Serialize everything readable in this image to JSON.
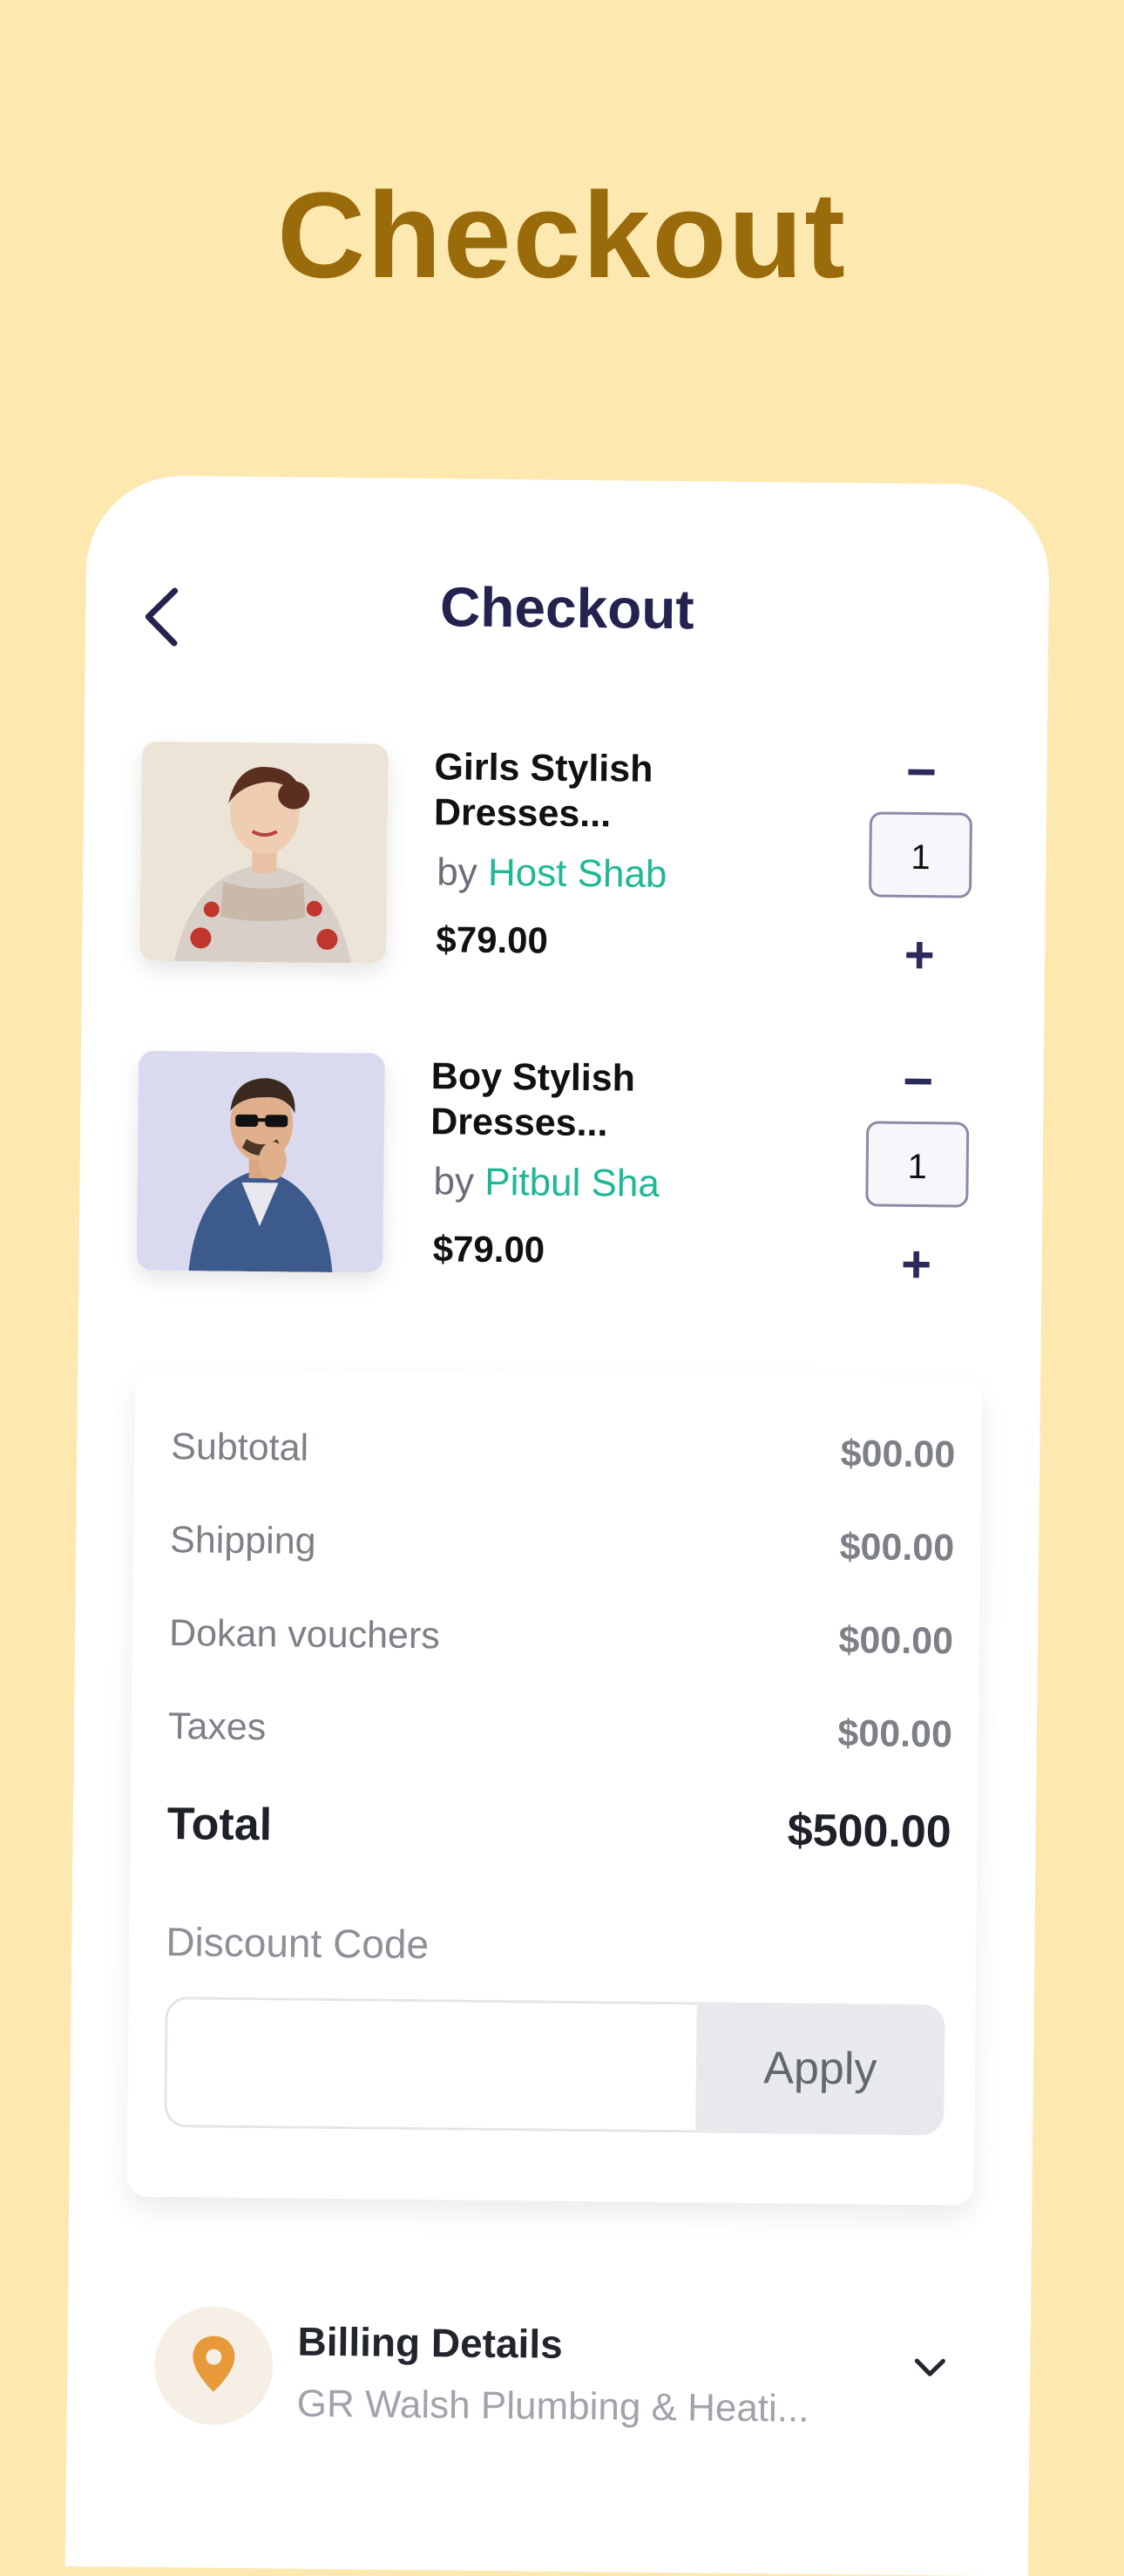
{
  "hero": {
    "title": "Checkout"
  },
  "header": {
    "title": "Checkout"
  },
  "items": [
    {
      "name": "Girls Stylish Dresses...",
      "by": "by",
      "seller": "Host Shab",
      "price": "$79.00",
      "quantity": "1"
    },
    {
      "name": "Boy Stylish Dresses...",
      "by": "by",
      "seller": "Pitbul Sha",
      "price": "$79.00",
      "quantity": "1"
    }
  ],
  "qty_controls": {
    "minus": "−",
    "plus": "+"
  },
  "summary": {
    "subtotal_label": "Subtotal",
    "subtotal_value": "$00.00",
    "shipping_label": "Shipping",
    "shipping_value": "$00.00",
    "vouchers_label": "Dokan vouchers",
    "vouchers_value": "$00.00",
    "taxes_label": "Taxes",
    "taxes_value": "$00.00",
    "total_label": "Total",
    "total_value": "$500.00"
  },
  "discount": {
    "label": "Discount Code",
    "input_value": "",
    "apply_label": "Apply"
  },
  "billing": {
    "title": "Billing Details",
    "subtitle": "GR Walsh Plumbing & Heati..."
  },
  "colors": {
    "background": "#fde8b0",
    "hero_title": "#9a6b0a",
    "header_title": "#24234f",
    "seller_accent": "#1fb896",
    "pin": "#e8993a"
  },
  "icons": {
    "back": "chevron-left-icon",
    "location": "location-pin-icon",
    "expand": "chevron-down-icon"
  }
}
